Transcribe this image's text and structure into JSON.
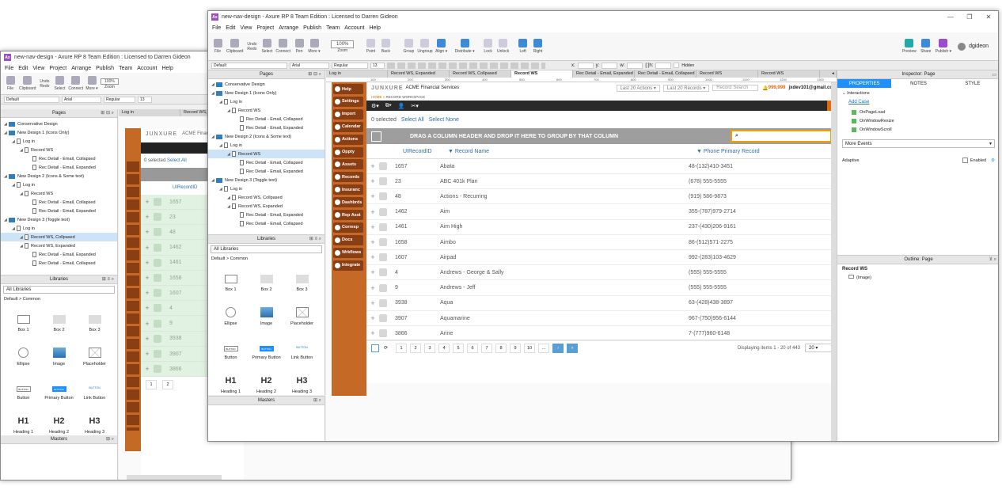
{
  "windows": {
    "back": {
      "title": "new-nav-design - Axure RP 8 Team Edition : Licensed to Darren Gideon",
      "zoom": "100%"
    },
    "front": {
      "title": "new-nav-design - Axure RP 8 Team Edition : Licensed to Darren Gideon",
      "zoom": "100%",
      "user": "dgideon"
    }
  },
  "app_icon": "Ax",
  "win_controls": [
    "—",
    "❐",
    "✕"
  ],
  "menu": [
    "File",
    "Edit",
    "View",
    "Project",
    "Arrange",
    "Publish",
    "Team",
    "Account",
    "Help"
  ],
  "toolbar": {
    "file": "File",
    "clipboard": "Clipboard",
    "undo": "Undo",
    "redo": "Redo",
    "select": "Select",
    "connect": "Connect",
    "pen": "Pen",
    "more": "More ▾",
    "zoom": "Zoom",
    "point": "Point",
    "back": "Back",
    "group": "Group",
    "ungroup": "Ungroup",
    "align": "Align ▾",
    "distribute": "Distribute ▾",
    "lock": "Lock",
    "unlock": "Unlock",
    "left": "Left",
    "right": "Right",
    "preview": "Preview",
    "share": "Share",
    "publish": "Publish ▾"
  },
  "format": {
    "style": "Default",
    "font": "Arial",
    "weight": "Regular",
    "size": "13",
    "x": "x:",
    "y": "y:",
    "w": "w:",
    "h": "[:]h:",
    "hidden": "Hidden"
  },
  "panels": {
    "pages": "Pages",
    "libraries": "Libraries",
    "masters": "Masters",
    "inspector": "Inspector: Page",
    "outline": "Outline: Page"
  },
  "pages_tree": [
    {
      "label": "Conservative Design",
      "level": 0,
      "type": "folder"
    },
    {
      "label": "New Design 1 (Icons Only)",
      "level": 0,
      "type": "folder"
    },
    {
      "label": "Log in",
      "level": 1,
      "type": "page"
    },
    {
      "label": "Record WS",
      "level": 2,
      "type": "page"
    },
    {
      "label": "Rec Detail - Email, Collapsed",
      "level": 3,
      "type": "page"
    },
    {
      "label": "Rec Detail - Email, Expanded",
      "level": 3,
      "type": "page"
    },
    {
      "label": "New Design 2 (Icons & Some text)",
      "level": 0,
      "type": "folder"
    },
    {
      "label": "Log in",
      "level": 1,
      "type": "page"
    },
    {
      "label": "Record WS",
      "level": 2,
      "type": "page",
      "selected": true
    },
    {
      "label": "Rec Detail - Email, Collapsed",
      "level": 3,
      "type": "page"
    },
    {
      "label": "Rec Detail - Email, Expanded",
      "level": 3,
      "type": "page"
    },
    {
      "label": "New Design 3 (Toggle text)",
      "level": 0,
      "type": "folder"
    },
    {
      "label": "Log in",
      "level": 1,
      "type": "page"
    },
    {
      "label": "Record WS, Collpased",
      "level": 2,
      "type": "page"
    },
    {
      "label": "Record WS, Expanded",
      "level": 2,
      "type": "page"
    },
    {
      "label": "Rec Detail - Email, Expanded",
      "level": 3,
      "type": "page"
    },
    {
      "label": "Rec Detail - Email, Collapsed",
      "level": 3,
      "type": "page"
    }
  ],
  "back_pages_tree": [
    {
      "label": "Conservative Design",
      "level": 0,
      "type": "folder"
    },
    {
      "label": "New Design 1 (Icons Only)",
      "level": 0,
      "type": "folder"
    },
    {
      "label": "Log in",
      "level": 1,
      "type": "page"
    },
    {
      "label": "Record WS",
      "level": 2,
      "type": "page"
    },
    {
      "label": "Rec Detail - Email, Collapsed",
      "level": 3,
      "type": "page"
    },
    {
      "label": "Rec Detail - Email, Expanded",
      "level": 3,
      "type": "page"
    },
    {
      "label": "New Design 2 (Icons & Some text)",
      "level": 0,
      "type": "folder"
    },
    {
      "label": "Log in",
      "level": 1,
      "type": "page"
    },
    {
      "label": "Record WS",
      "level": 2,
      "type": "page"
    },
    {
      "label": "Rec Detail - Email, Collapsed",
      "level": 3,
      "type": "page"
    },
    {
      "label": "Rec Detail - Email, Expanded",
      "level": 3,
      "type": "page"
    },
    {
      "label": "New Design 3 (Toggle text)",
      "level": 0,
      "type": "folder"
    },
    {
      "label": "Log in",
      "level": 1,
      "type": "page"
    },
    {
      "label": "Record WS, Collpased",
      "level": 2,
      "type": "page",
      "selected": true
    },
    {
      "label": "Record WS, Expanded",
      "level": 2,
      "type": "page"
    },
    {
      "label": "Rec Detail - Email, Expanded",
      "level": 3,
      "type": "page"
    },
    {
      "label": "Rec Detail - Email, Collapsed",
      "level": 3,
      "type": "page"
    }
  ],
  "library": {
    "dropdown": "All Libraries",
    "group": "Default > Common",
    "items": [
      "Box 1",
      "Box 2",
      "Box 3",
      "Ellipse",
      "Image",
      "Placeholder",
      "Button",
      "Primary Button",
      "Link Button",
      "Heading 1",
      "Heading 2",
      "Heading 3"
    ],
    "button_text": "BUTTON",
    "h1": "H1",
    "h2": "H2",
    "h3": "H3"
  },
  "doc_tabs": [
    "Log in",
    "Record WS, Expanded",
    "Record WS, Collpased",
    "Record WS",
    "Rec Detail - Email, Expanded",
    "Rec Detail - Email, Collapsed",
    "Record WS",
    "Record WS"
  ],
  "back_doc_tabs": [
    "Log in",
    "Record WS, Expanded"
  ],
  "ruler_marks": [
    "100",
    "200",
    "300",
    "400",
    "500",
    "600",
    "700",
    "800",
    "900",
    "1000",
    "1100",
    "1200",
    "1300"
  ],
  "app": {
    "logo": "JUNXURE",
    "company": "ACME Financial Services",
    "last_actions": "Last 20 Actions ▾",
    "last_records": "Last 20 Records ▾",
    "search": "Record Search",
    "alerts": "999,999",
    "user_email": "jxdev101@gmail.co...",
    "breadcrumb_home": "HOME",
    "breadcrumb_sep": "»",
    "breadcrumb_page": "RECORD WORKSPACE",
    "selected_count": "0 selected",
    "select_all": "Select All",
    "select_none": "Select None",
    "group_hint": "DRAG A COLUMN HEADER AND DROP IT HERE TO GROUP BY THAT COLUMN",
    "columns": [
      "UIRecordID",
      "Record Name",
      "Phone Primary Record"
    ],
    "rows": [
      [
        "1657",
        "Abata",
        "48-(132)410-3451"
      ],
      [
        "23",
        "ABC 401k Plan",
        "(678) 555-5555"
      ],
      [
        "48",
        "Actions - Recurring",
        "(919) 586-9873"
      ],
      [
        "1462",
        "Aim",
        "355-(787)979-2714"
      ],
      [
        "1461",
        "Aim High",
        "237-(430)206-9161"
      ],
      [
        "1658",
        "Aimbo",
        "86-(512)571-2275"
      ],
      [
        "1607",
        "Airpad",
        "992-(283)103-4629"
      ],
      [
        "4",
        "Andrews - George & Sally",
        "(555) 555-5555"
      ],
      [
        "9",
        "Andrews - Jeff",
        "(555) 555-5555"
      ],
      [
        "3938",
        "Aqua",
        "63-(428)438-3897"
      ],
      [
        "3907",
        "Aquamarine",
        "967-(750)956-6144"
      ],
      [
        "3866",
        "Arine",
        "7-(777)960-6148"
      ]
    ],
    "pages": [
      "1",
      "2",
      "3",
      "4",
      "5",
      "6",
      "7",
      "8",
      "9",
      "10",
      "..."
    ],
    "next": "›",
    "last": "»",
    "display_info": "Displaying items 1 - 20 of 443",
    "page_size": "20",
    "nav": [
      "Help",
      "Settings",
      "Import",
      "Calendar",
      "Actions",
      "Oppty",
      "Assets",
      "Records",
      "Insuranc",
      "Dashbrds",
      "Rep Asst",
      "Corresp",
      "Docs",
      "Wrkflows",
      "Integrate"
    ],
    "back_ids": [
      "1657",
      "23",
      "48",
      "1462",
      "1461",
      "1658",
      "1607",
      "4",
      "9",
      "3938",
      "3907",
      "3866"
    ],
    "back_pages": [
      "1",
      "2"
    ]
  },
  "inspector": {
    "tabs": [
      "PROPERTIES",
      "NOTES",
      "STYLE"
    ],
    "interactions": "Interactions",
    "add_case": "Add Case",
    "events": [
      "OnPageLoad",
      "OnWindowResize",
      "OnWindowScroll"
    ],
    "more_events": "More Events",
    "adaptive": "Adaptive",
    "enabled": "Enabled"
  },
  "outline": {
    "root": "Record WS",
    "child": "(Image)"
  },
  "colors": {
    "accent": "#1e90ff",
    "rail": "#c46a26",
    "nav_button": "#8a3e13",
    "selected_row": "#cde3f7",
    "grid_header": "#9e9e9e"
  }
}
